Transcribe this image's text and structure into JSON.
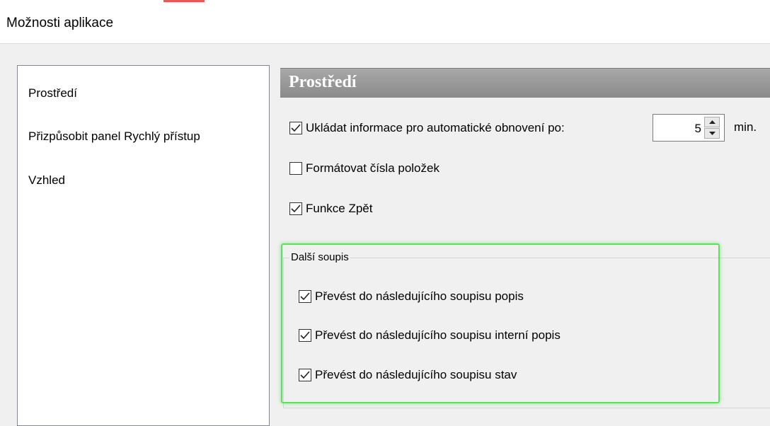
{
  "window": {
    "title": "Možnosti aplikace"
  },
  "sidebar": {
    "items": [
      {
        "label": "Prostředí"
      },
      {
        "label": "Přizpůsobit panel Rychlý přístup"
      },
      {
        "label": "Vzhled"
      }
    ]
  },
  "section": {
    "header": "Prostředí",
    "autosave": {
      "label": "Ukládat informace pro automatické obnovení po:",
      "checked": true,
      "value": "5",
      "unit": "min."
    },
    "format_numbers": {
      "label": "Formátovat čísla položek",
      "checked": false
    },
    "undo": {
      "label": "Funkce Zpět",
      "checked": true
    },
    "next_list": {
      "legend": "Další soupis",
      "options": [
        {
          "label": "Převést do následujícího soupisu popis",
          "checked": true
        },
        {
          "label": "Převést do následujícího soupisu interní popis",
          "checked": true
        },
        {
          "label": "Převést do následujícího soupisu stav",
          "checked": true
        }
      ]
    }
  },
  "colors": {
    "highlight": "#5ee05e",
    "header_bg": "#999999",
    "window_bg": "#f0f0f0"
  },
  "icons": {
    "check": "checkmark-icon",
    "up": "arrow-up-icon",
    "down": "arrow-down-icon"
  }
}
